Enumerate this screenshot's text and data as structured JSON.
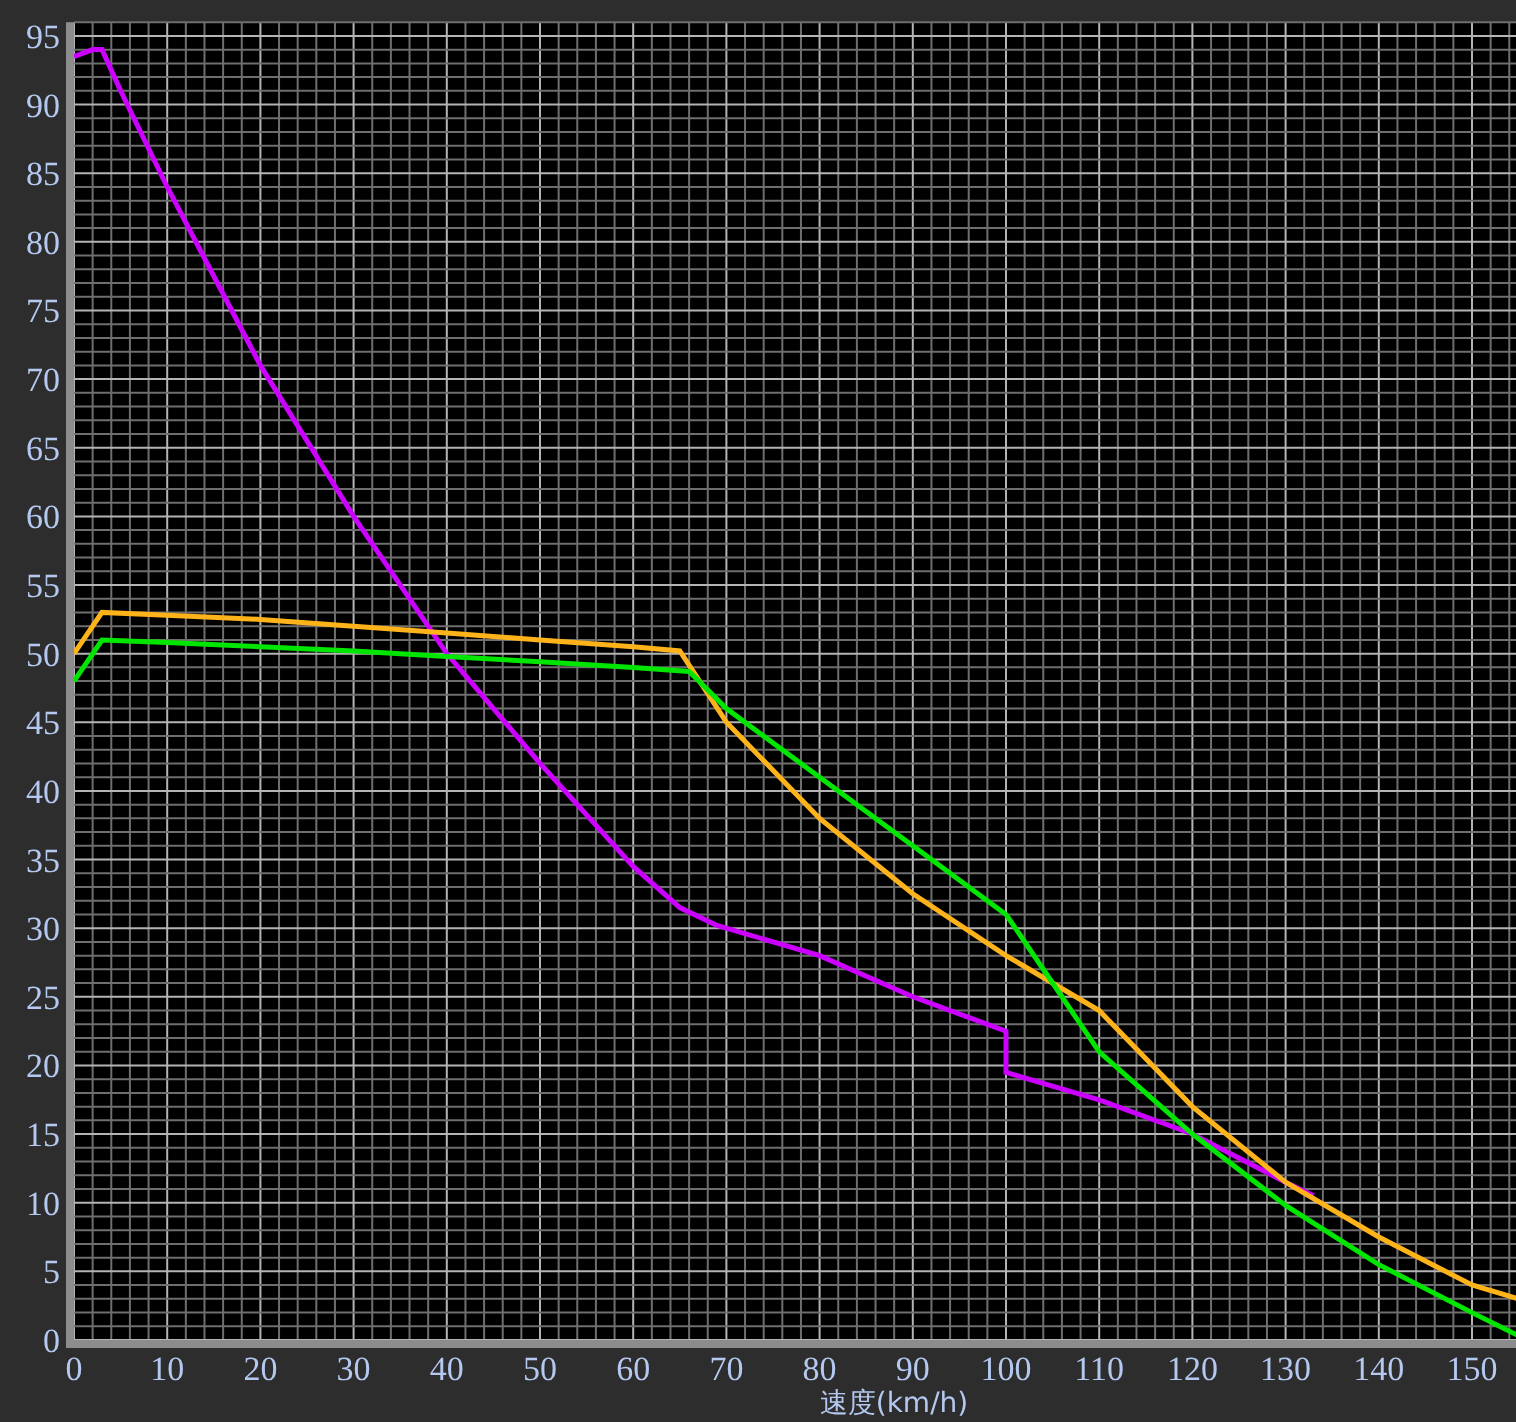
{
  "chart_data": {
    "type": "line",
    "xlabel": "速度(km/h)",
    "grid": true,
    "xlim": [
      0,
      155
    ],
    "ylim": [
      0,
      96
    ],
    "xticks": [
      0,
      10,
      20,
      30,
      40,
      50,
      60,
      70,
      80,
      90,
      100,
      110,
      120,
      130,
      140,
      150
    ],
    "yticks": [
      0,
      5,
      10,
      15,
      20,
      25,
      30,
      35,
      40,
      45,
      50,
      55,
      60,
      65,
      70,
      75,
      80,
      85,
      90,
      95
    ],
    "series": [
      {
        "color": "#cc00ff",
        "x": [
          0,
          2,
          3,
          5,
          10,
          20,
          30,
          40,
          50,
          60,
          65,
          69,
          80,
          90,
          100,
          100,
          110,
          120,
          130,
          133
        ],
        "values": [
          93.5,
          94,
          94,
          91,
          84,
          71,
          60,
          50,
          42,
          34.5,
          31.5,
          30.2,
          28,
          25,
          22.5,
          19.5,
          17.5,
          15,
          11.5,
          10.5
        ]
      },
      {
        "color": "#ffb31a",
        "x": [
          0,
          3,
          10,
          20,
          30,
          40,
          50,
          60,
          65,
          70,
          80,
          90,
          100,
          110,
          120,
          130,
          140,
          150,
          155
        ],
        "values": [
          50,
          53,
          52.8,
          52.5,
          52,
          51.5,
          51,
          50.5,
          50.2,
          45,
          38,
          32.5,
          28,
          24,
          17,
          11.5,
          7.5,
          4,
          3
        ]
      },
      {
        "color": "#00e600",
        "x": [
          0,
          3,
          10,
          20,
          30,
          40,
          50,
          60,
          66,
          70,
          80,
          90,
          100,
          101,
          110,
          120,
          130,
          140,
          150,
          155
        ],
        "values": [
          48,
          51,
          50.8,
          50.5,
          50.2,
          49.8,
          49.4,
          49,
          48.7,
          46,
          41,
          36,
          31,
          30,
          21,
          15,
          9.8,
          5.5,
          2,
          0.3
        ]
      }
    ]
  }
}
